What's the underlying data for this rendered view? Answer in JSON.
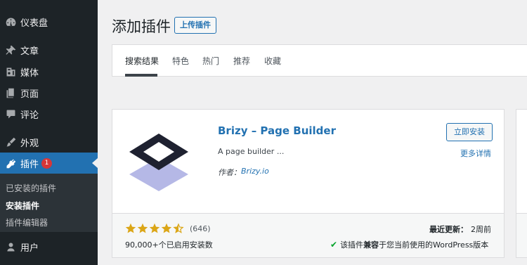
{
  "sidebar": {
    "items": [
      {
        "label": "仪表盘",
        "icon": "dashboard-icon"
      },
      {
        "label": "文章",
        "icon": "pin-icon"
      },
      {
        "label": "媒体",
        "icon": "media-icon"
      },
      {
        "label": "页面",
        "icon": "page-icon"
      },
      {
        "label": "评论",
        "icon": "comment-icon"
      },
      {
        "label": "外观",
        "icon": "brush-icon"
      },
      {
        "label": "插件",
        "icon": "plugin-icon",
        "badge": "1"
      },
      {
        "label": "用户",
        "icon": "user-icon"
      }
    ],
    "submenu": [
      "已安装的插件",
      "安装插件",
      "插件编辑器"
    ]
  },
  "header": {
    "title": "添加插件",
    "upload_label": "上传插件"
  },
  "tabs": [
    "搜索结果",
    "特色",
    "热门",
    "推荐",
    "收藏"
  ],
  "plugin": {
    "name": "Brizy – Page Builder",
    "description": "A page builder ...",
    "author_label": "作者：",
    "author": "Brizy.io",
    "install_label": "立即安装",
    "more_label": "更多详情",
    "rating": 4.5,
    "rating_count": "(646)",
    "installs": "90,000+个已启用安装数",
    "updated_label": "最近更新：",
    "updated_value": "2周前",
    "compat_prefix": "该插件",
    "compat_bold": "兼容",
    "compat_suffix": "于您当前使用的WordPress版本"
  },
  "colors": {
    "sidebar_bg": "#1d2327",
    "accent": "#2271b1",
    "badge": "#d63638",
    "star": "#dba617",
    "check": "#00a32a"
  }
}
